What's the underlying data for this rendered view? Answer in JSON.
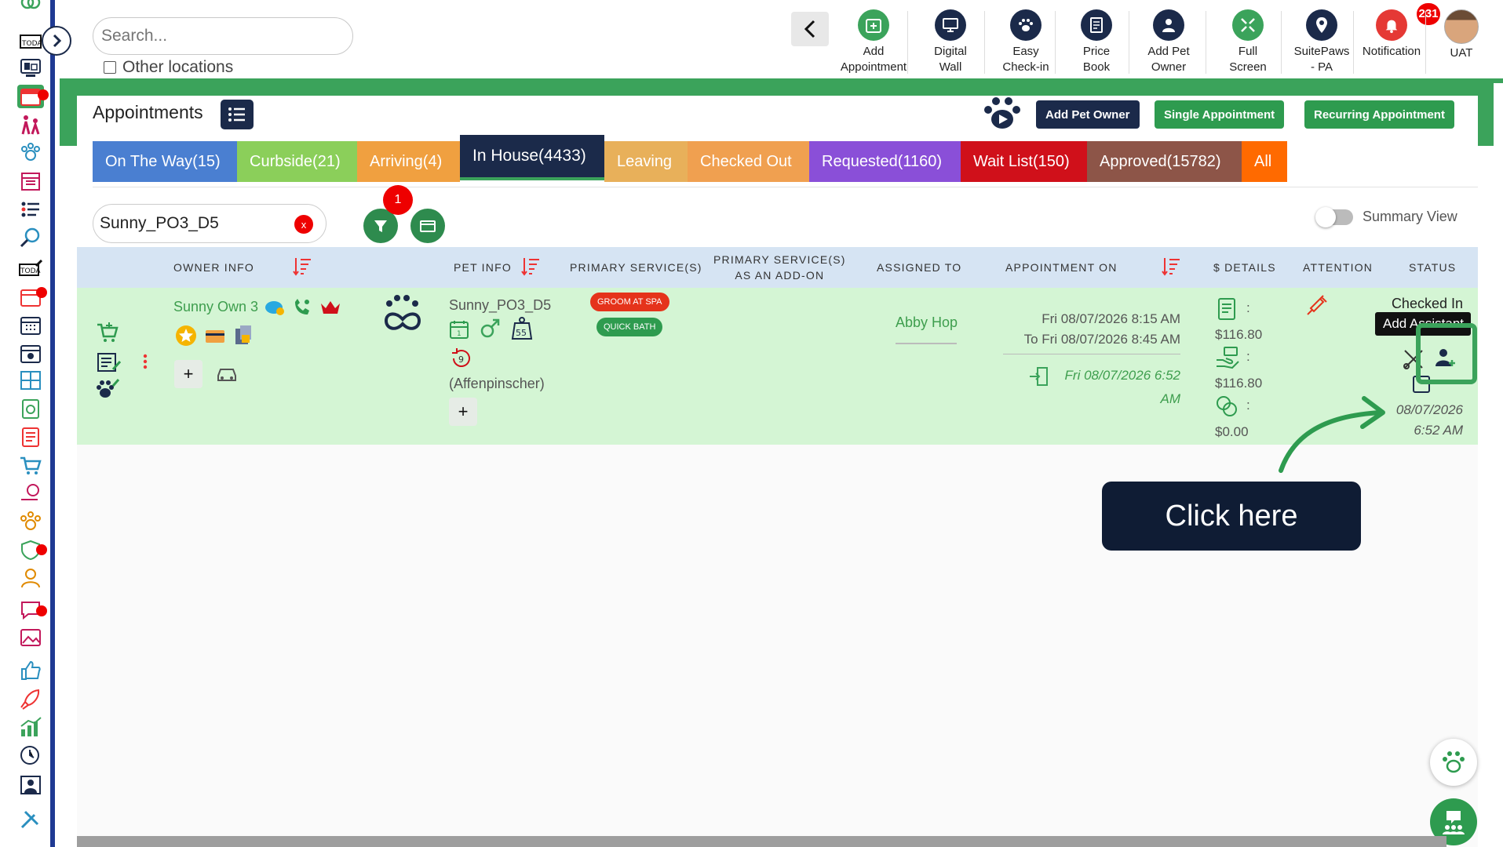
{
  "header": {
    "search_placeholder": "Search...",
    "other_locations_label": "Other locations",
    "tools": [
      {
        "label_line1": "Add",
        "label_line2": "Appointment",
        "icon": "calendar-plus-icon",
        "color": "#3ba35b"
      },
      {
        "label_line1": "Digital",
        "label_line2": "Wall",
        "icon": "monitor-icon",
        "color": "#1b2a4a"
      },
      {
        "label_line1": "Easy",
        "label_line2": "Check-in",
        "icon": "paw-icon",
        "color": "#1b2a4a"
      },
      {
        "label_line1": "Price",
        "label_line2": "Book",
        "icon": "document-icon",
        "color": "#1b2a4a"
      },
      {
        "label_line1": "Add Pet",
        "label_line2": "Owner",
        "icon": "add-user-icon",
        "color": "#1b2a4a"
      },
      {
        "label_line1": "Full",
        "label_line2": "Screen",
        "icon": "fullscreen-icon",
        "color": "#3ba35b"
      },
      {
        "label_line1": "SuitePaws",
        "label_line2": "- PA",
        "icon": "location-pin-icon",
        "color": "#1b2a4a"
      },
      {
        "label_line1": "Notification",
        "label_line2": "",
        "icon": "bell-icon",
        "color": "#e53935",
        "badge": "231"
      },
      {
        "label_line1": "UAT",
        "label_line2": "",
        "icon": "user-avatar",
        "color": "#6b4c35"
      }
    ]
  },
  "page": {
    "title": "Appointments",
    "buttons": {
      "add_pet_owner": "Add Pet Owner",
      "single_appointment": "Single Appointment",
      "recurring_appointment": "Recurring Appointment"
    },
    "tabs": [
      {
        "label": "On The Way(15)",
        "color": "#4a7fd1"
      },
      {
        "label": "Curbside(21)",
        "color": "#8bcf5a"
      },
      {
        "label": "Arriving(4)",
        "color": "#f0a040"
      },
      {
        "label": "In House(4433)",
        "color": "#1b2a4a",
        "active": true
      },
      {
        "label": "Leaving",
        "color": "#e8b05a"
      },
      {
        "label": "Checked Out",
        "color": "#f0a050"
      },
      {
        "label": "Requested(1160)",
        "color": "#8a4fd8"
      },
      {
        "label": "Wait List(150)",
        "color": "#d0101a"
      },
      {
        "label": "Approved(15782)",
        "color": "#8d5548"
      },
      {
        "label": "All",
        "color": "#ff6a00"
      }
    ],
    "filter_value": "Sunny_PO3_D5",
    "filter_count": "1",
    "summary_view_label": "Summary View"
  },
  "table": {
    "columns": {
      "owner_info": "OWNER INFO",
      "pet_info": "PET INFO",
      "primary_services": "PRIMARY SERVICE(S)",
      "primary_addon_line1": "PRIMARY SERVICE(S)",
      "primary_addon_line2": "AS AN ADD-ON",
      "assigned_to": "ASSIGNED TO",
      "appointment_on": "APPOINTMENT ON",
      "details": "$ DETAILS",
      "attention": "ATTENTION",
      "status": "STATUS"
    },
    "row": {
      "owner_name": "Sunny Own 3",
      "pet_name": "Sunny_PO3_D5",
      "pet_weight": "55",
      "pet_visits": "9",
      "pet_breed": "(Affenpinscher)",
      "services": [
        {
          "label": "GROOM AT SPA",
          "color": "#e5331b"
        },
        {
          "label": "QUICK BATH",
          "color": "#2e9b4f"
        }
      ],
      "assigned_to": "Abby Hop",
      "appointment_from": "Fri 08/07/2026 8:15 AM",
      "appointment_to": "To Fri 08/07/2026 8:45 AM",
      "checkin_line1": "Fri 08/07/2026 6:52",
      "checkin_line2": "AM",
      "details": [
        {
          "icon": "invoice-icon",
          "sep": ":",
          "amount": "$116.80"
        },
        {
          "icon": "hand-money-icon",
          "sep": ":",
          "amount": "$116.80"
        },
        {
          "icon": "coins-icon",
          "sep": ":",
          "amount": "$0.00"
        }
      ],
      "status": "Checked In",
      "status_date": "08/07/2026",
      "status_time": "6:52 AM",
      "tooltip": "Add Assistant"
    }
  },
  "callout": {
    "label": "Click here"
  }
}
